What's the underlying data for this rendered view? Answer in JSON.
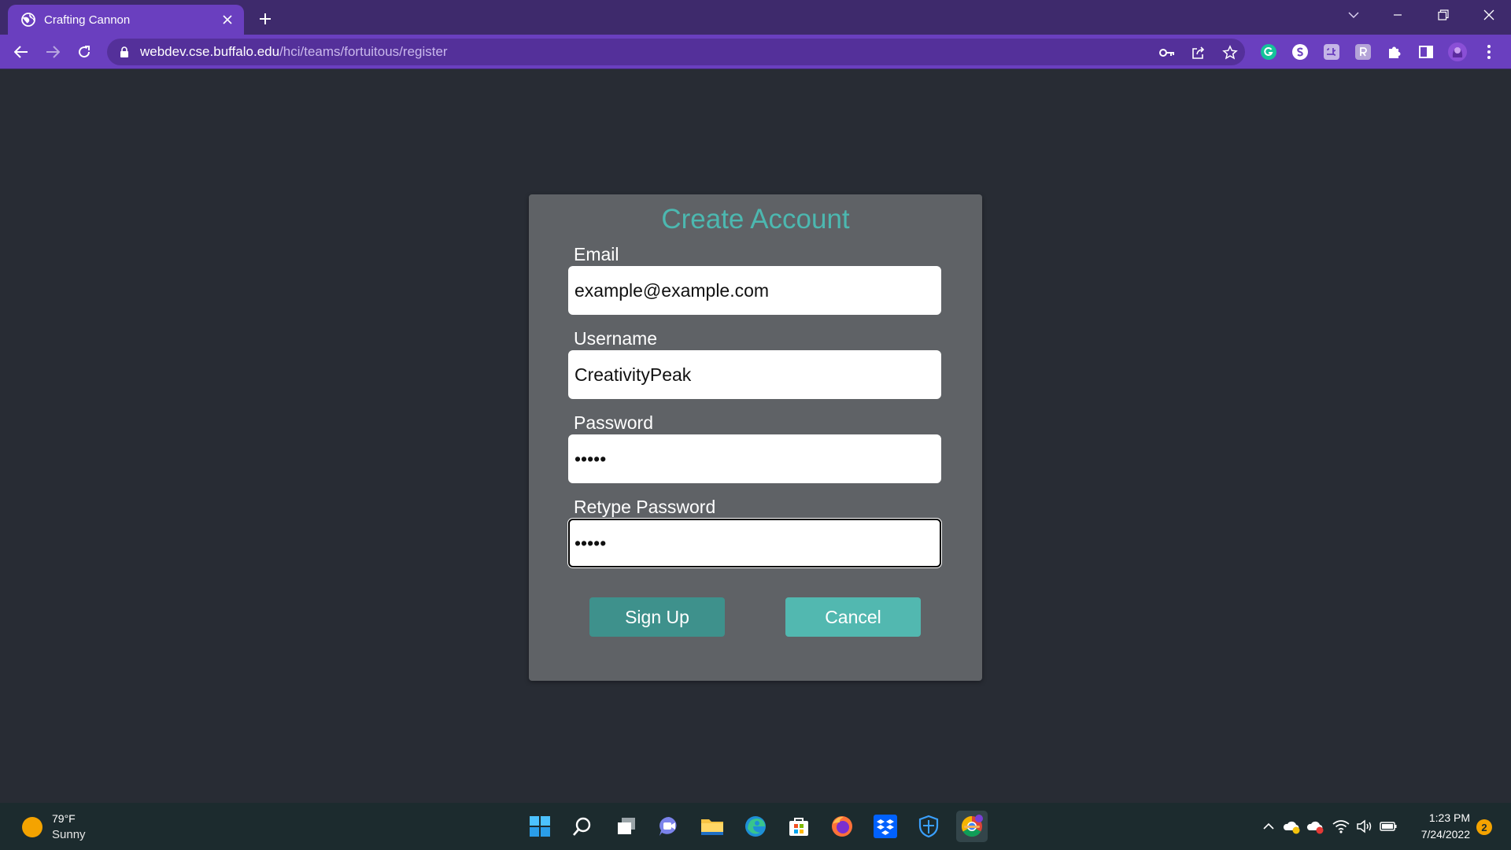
{
  "browser": {
    "tab_title": "Crafting Cannon",
    "url_host": "webdev.cse.buffalo.edu",
    "url_path": "/hci/teams/fortuitous/register"
  },
  "form": {
    "title": "Create Account",
    "email_label": "Email",
    "email_value": "example@example.com",
    "username_label": "Username",
    "username_value": "CreativityPeak",
    "password_label": "Password",
    "password_value": "•••••",
    "retype_label": "Retype Password",
    "retype_value": "•••••",
    "signup_label": "Sign Up",
    "cancel_label": "Cancel"
  },
  "taskbar": {
    "weather_temp": "79°F",
    "weather_condition": "Sunny",
    "clock_time": "1:23 PM",
    "clock_date": "7/24/2022",
    "notification_count": "2"
  },
  "colors": {
    "tab_bar": "#3e2a6c",
    "toolbar": "#6a3fbf",
    "page_background": "#282c34",
    "card": "#5f6266",
    "accent_title": "#4cb8b0",
    "signup_button": "#3e918c",
    "cancel_button": "#52b8b0"
  },
  "icons": {
    "tab_favicon": "globe-icon",
    "tab_close": "close-icon",
    "new_tab": "plus-icon",
    "back": "back-arrow-icon",
    "forward": "forward-arrow-icon",
    "reload": "reload-icon",
    "lock": "lock-icon",
    "key": "key-icon",
    "share": "share-icon",
    "bookmark": "star-icon",
    "extensions": "puzzle-icon",
    "side_panel": "side-panel-icon",
    "menu": "kebab-menu-icon"
  }
}
